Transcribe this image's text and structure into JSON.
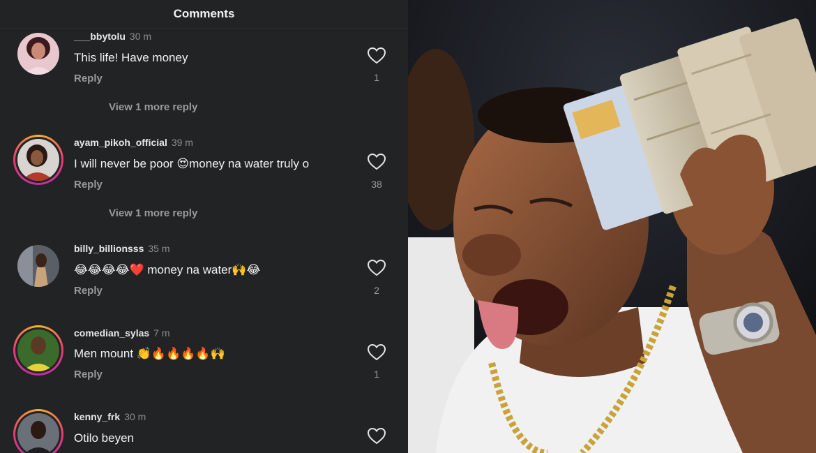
{
  "header": {
    "title": "Comments"
  },
  "comments": [
    {
      "username": "___bbytolu",
      "time": "30 m",
      "text": "This life! Have money",
      "reply_label": "Reply",
      "likes": "1",
      "more_replies": "View 1 more reply",
      "avatar_ring": false
    },
    {
      "username": "ayam_pikoh_official",
      "time": "39 m",
      "text": "I will never be poor 😍money na water truly o",
      "reply_label": "Reply",
      "likes": "38",
      "more_replies": "View 1 more reply",
      "avatar_ring": true
    },
    {
      "username": "billy_billionsss",
      "time": "35 m",
      "text": "😂😂😂😂❤️ money na water🙌😂",
      "reply_label": "Reply",
      "likes": "2",
      "avatar_ring": false
    },
    {
      "username": "comedian_sylas",
      "time": "7 m",
      "text": "Men mount 👏🔥🔥🔥🔥🙌",
      "reply_label": "Reply",
      "likes": "1",
      "avatar_ring": true
    },
    {
      "username": "kenny_frk",
      "time": "30 m",
      "text": "Otilo beyen",
      "avatar_ring": true
    }
  ],
  "colors": {
    "panel_bg": "#222325",
    "ring_gradient": [
      "#f7b32b",
      "#e63b72",
      "#c02cb0"
    ],
    "heart_stroke": "#e6e6e6"
  },
  "icons": [
    "heart-outline-icon"
  ],
  "photo": {
    "subject": "man-with-cash-photo"
  }
}
